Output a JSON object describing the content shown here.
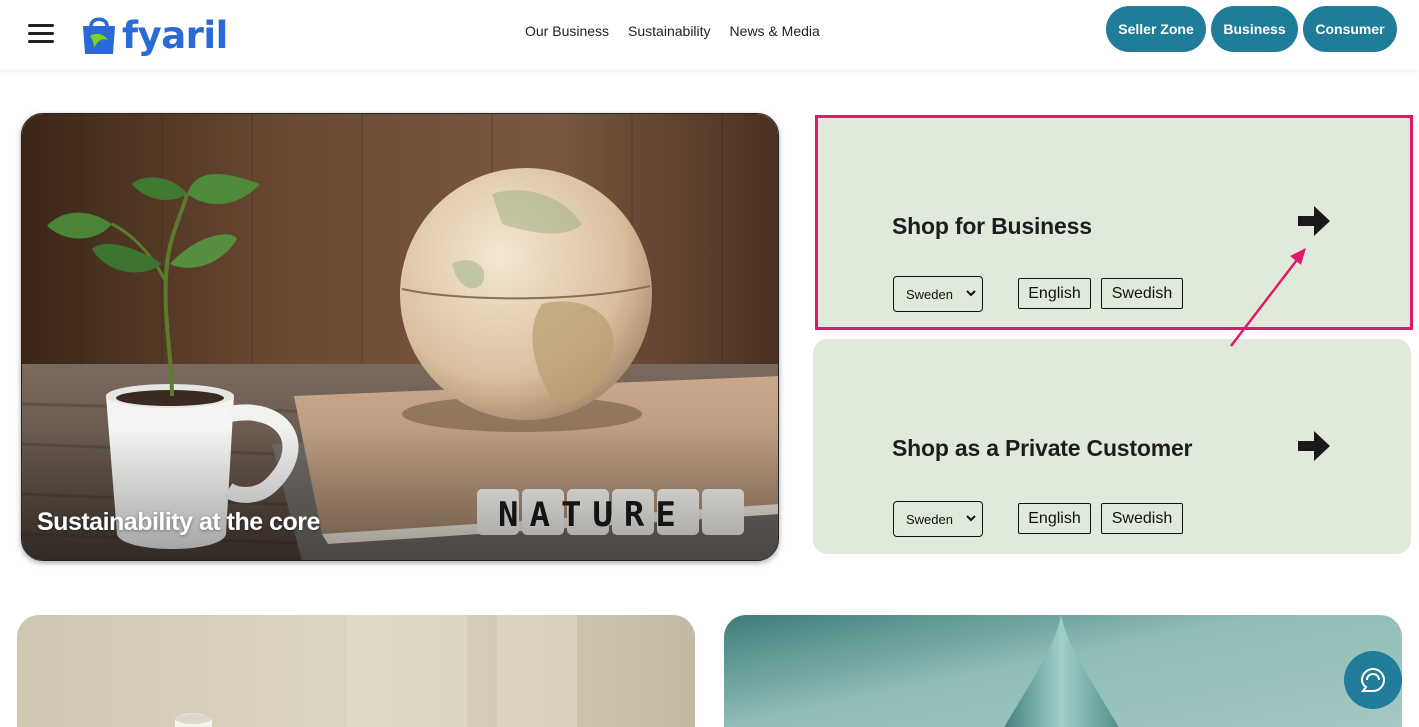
{
  "header": {
    "logo_text": "fyaril",
    "nav": [
      {
        "label": "Our Business"
      },
      {
        "label": "Sustainability"
      },
      {
        "label": "News & Media"
      }
    ],
    "buttons": {
      "seller_zone": "Seller Zone",
      "business": "Business",
      "consumer": "Consumer"
    }
  },
  "hero": {
    "caption": "Sustainability at the core",
    "dice_text": "NATURE"
  },
  "shop_business": {
    "title": "Shop for Business",
    "country_selected": "Sweden",
    "lang_1": "English",
    "lang_2": "Swedish"
  },
  "shop_private": {
    "title": "Shop as a Private Customer",
    "country_selected": "Sweden",
    "lang_1": "English",
    "lang_2": "Swedish"
  },
  "colors": {
    "brand_blue": "#2a6ad6",
    "button_teal": "#1f7d9a",
    "card_green": "#e0eadb",
    "highlight_pink": "#e0196c"
  },
  "icons": {
    "menu": "hamburger-icon",
    "arrow": "arrow-right-icon",
    "chat": "chat-icon"
  }
}
